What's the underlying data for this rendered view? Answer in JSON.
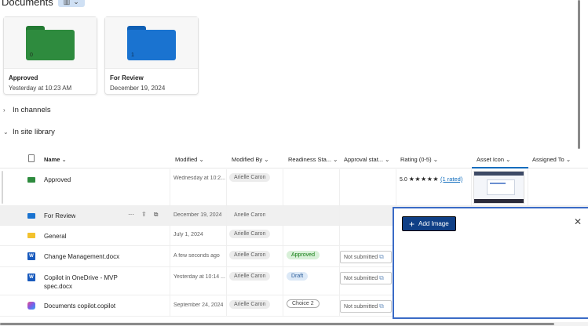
{
  "header": {
    "title": "Documents",
    "view_icon": "grid-icon"
  },
  "tiles": [
    {
      "name": "Approved",
      "date": "Yesterday at 10:23 AM",
      "count": "0",
      "color": "#2e8b3e"
    },
    {
      "name": "For Review",
      "date": "December 19, 2024",
      "count": "1",
      "color": "#1a73d0"
    }
  ],
  "sections": {
    "channels": "In channels",
    "library": "In site library"
  },
  "columns": {
    "name": "Name",
    "modified": "Modified",
    "modified_by": "Modified By",
    "readiness": "Readiness Sta...",
    "approval": "Approval stat...",
    "rating": "Rating (0-5)",
    "asset_icon": "Asset Icon",
    "assigned_to": "Assigned To"
  },
  "rows": [
    {
      "name": "Approved",
      "type": "folder",
      "modified": "Wednesday at 10:2...",
      "modified_by": "Arielle Caron",
      "rating_value": "5.0",
      "rating_stars": "★★★★★",
      "rating_link": "(1 rated)"
    },
    {
      "name": "For Review",
      "type": "folder",
      "modified": "December 19, 2024",
      "modified_by": "Arielle Caron"
    },
    {
      "name": "General",
      "type": "folder",
      "modified": "July 1, 2024",
      "modified_by": "Arielle Caron"
    },
    {
      "name": "Change Management.docx",
      "type": "word",
      "modified": "A few seconds ago",
      "modified_by": "Arielle Caron",
      "readiness": "Approved",
      "approval": "Not submitted"
    },
    {
      "name_line1": "Copilot in OneDrive - MVP",
      "name_line2": "spec.docx",
      "type": "word",
      "modified": "Yesterday at 10:14 ...",
      "modified_by": "Arielle Caron",
      "readiness": "Draft",
      "approval": "Not submitted"
    },
    {
      "name": "Documents copilot.copilot",
      "type": "copilot",
      "modified": "September 24, 2024",
      "modified_by": "Arielle Caron",
      "readiness": "Choice 2",
      "approval": "Not submitted"
    }
  ],
  "panel": {
    "add_image_label": "Add Image",
    "close_icon": "close-icon"
  },
  "colors": {
    "accent": "#0f6cbd",
    "panel_border": "#3a6bc6",
    "button": "#0f3f86",
    "folder_yellow": "#f2c12e"
  }
}
